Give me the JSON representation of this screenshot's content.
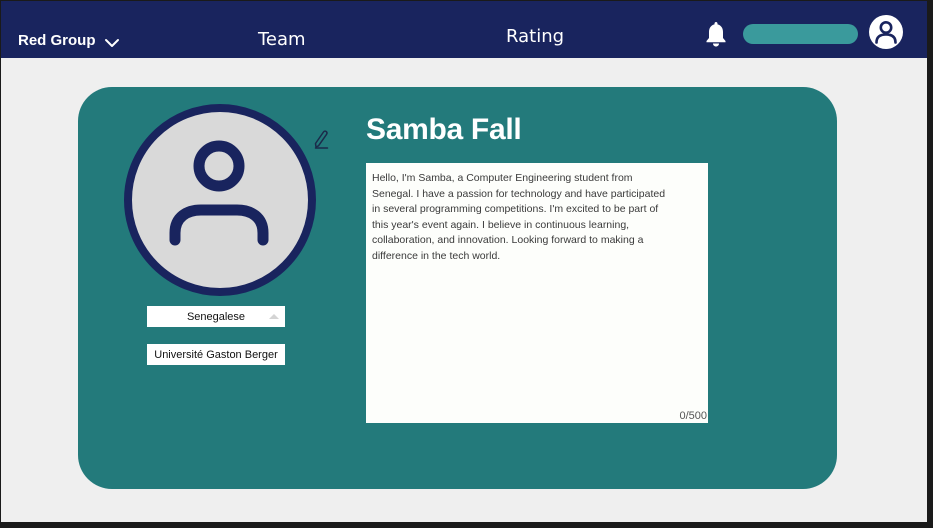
{
  "navbar": {
    "group_label": "Red Group",
    "links": [
      {
        "label": "Team"
      },
      {
        "label": "Rating"
      }
    ],
    "icons": {
      "group_dropdown": "chevron-down-icon",
      "notifications": "bell-icon",
      "account": "user-avatar-icon"
    }
  },
  "profile": {
    "name": "Samba Fall",
    "avatar_icon": "user-avatar-icon",
    "edit_icon": "pencil-icon",
    "nationality": "Senegalese",
    "university": "Université Gaston Berger",
    "bio": "Hello, I'm Samba, a Computer Engineering student from Senegal. I have a passion for technology and have participated in several programming competitions. I'm excited to be part of this year's event again. I believe in continuous learning, collaboration, and innovation. Looking forward to making a difference in the tech world.",
    "bio_counter": "0/500"
  },
  "colors": {
    "navbar": "#19245e",
    "card": "#237a7b",
    "accent_pill": "#3a9a9c",
    "page_background": "#efefef"
  }
}
